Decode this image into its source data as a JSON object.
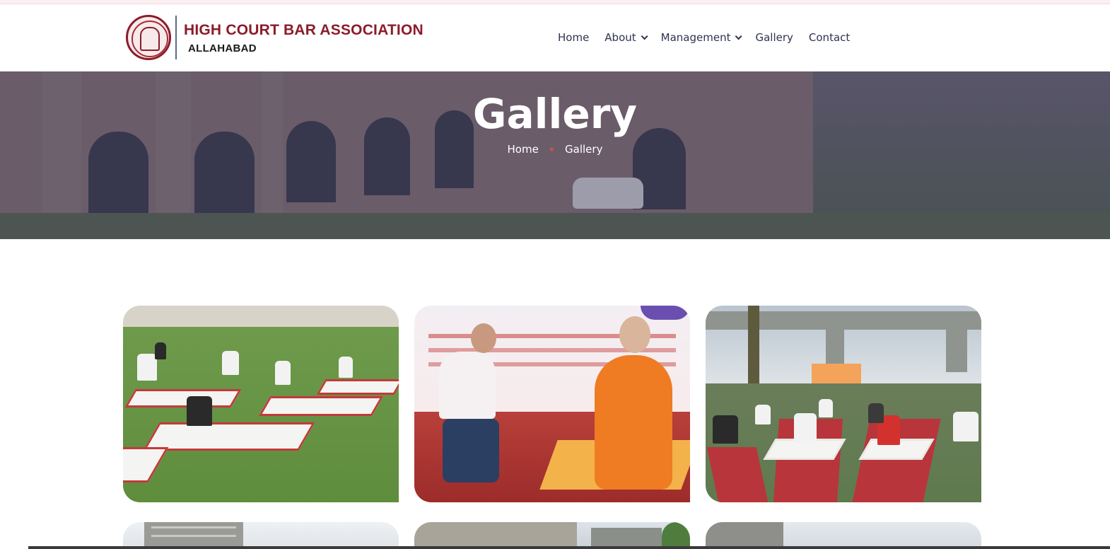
{
  "header": {
    "logo_line1": "HIGH COURT BAR ASSOCIATION",
    "logo_line2": "ALLAHABAD",
    "nav": [
      {
        "label": "Home",
        "has_dropdown": false
      },
      {
        "label": "About",
        "has_dropdown": true
      },
      {
        "label": "Management",
        "has_dropdown": true
      },
      {
        "label": "Gallery",
        "has_dropdown": false
      },
      {
        "label": "Contact",
        "has_dropdown": false
      }
    ]
  },
  "hero": {
    "title": "Gallery",
    "breadcrumb": {
      "home": "Home",
      "current": "Gallery"
    }
  },
  "gallery": {
    "images": [
      {
        "alt_icon": "yoga-on-lawn-photo"
      },
      {
        "alt_icon": "yoga-instructor-stage-photo"
      },
      {
        "alt_icon": "yoga-under-flyover-photo"
      },
      {
        "alt_icon": "building-photo"
      },
      {
        "alt_icon": "building-photo"
      },
      {
        "alt_icon": "building-photo"
      }
    ]
  },
  "colors": {
    "brand": "#8c1c2a",
    "nav_text": "#2e3352",
    "breadcrumb_separator": "#e5533d"
  }
}
